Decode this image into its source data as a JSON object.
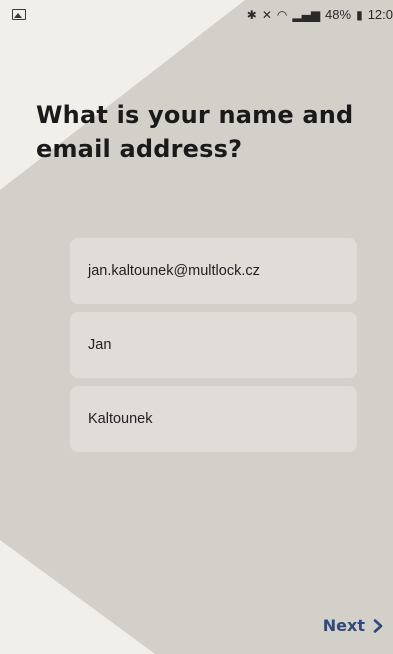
{
  "status_bar": {
    "icons": [
      "image-notification-icon",
      "bluetooth-icon",
      "mute-icon",
      "wifi-icon",
      "signal-icon",
      "battery-icon"
    ],
    "battery_percent": "48%",
    "time": "12:0"
  },
  "title": "What is your name and email address?",
  "fields": {
    "email": "jan.kaltounek@multlock.cz",
    "first_name": "Jan",
    "last_name": "Kaltounek"
  },
  "next_label": "Next",
  "colors": {
    "background_light": "#f1efea",
    "background_gray": "#d3d0ca",
    "field_bg": "#e0ddd9",
    "accent": "#2e4a7d"
  }
}
